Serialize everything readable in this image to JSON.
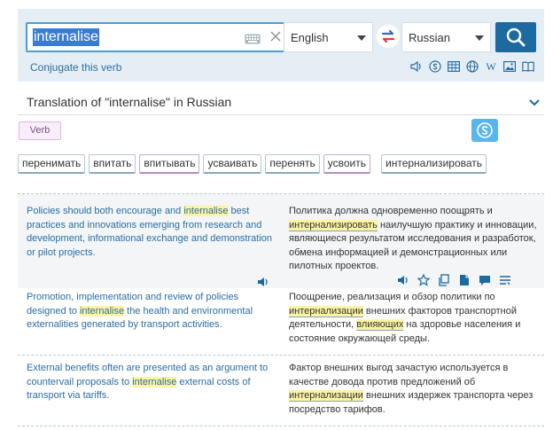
{
  "search": {
    "query": "internalise",
    "source_lang": "English",
    "target_lang": "Russian",
    "conjugate_label": "Conjugate this verb"
  },
  "tools": {
    "icons": [
      "speaker-icon",
      "skype-icon",
      "table-icon",
      "globe-icon",
      "wikipedia-icon",
      "image-icon",
      "book-icon"
    ],
    "wiki_glyph": "W"
  },
  "translation": {
    "title": "Translation of \"internalise\" in Russian",
    "pos": "Verb",
    "words": [
      "перенимать",
      "впитать",
      "впитывать",
      "усваивать",
      "перенять",
      "усвоить",
      "интернализировать"
    ]
  },
  "examples": [
    {
      "src": [
        "Policies should both encourage and ",
        "internalise",
        " best practices and innovations emerging from research and development, informational exchange and demonstration or pilot projects."
      ],
      "tgt_before": "Политика должна одновременно поощрять и ",
      "tgt_hl": "интернализировать",
      "tgt_after": " наилучшую практику и инновации, являющиеся результатом исследования и разработок, обмена информацией и демонстрационных или пилотных проектов."
    },
    {
      "src": [
        "Promotion, implementation and review of policies designed to ",
        "internalise",
        " the health and environmental externalities generated by transport activities."
      ],
      "tgt_before": "Поощрение, реализация и обзор политики по ",
      "tgt_hl": "интернализации",
      "tgt_mid": " внешних факторов транспортной деятельности, ",
      "tgt_ul": "влияющих",
      "tgt_after": " на здоровье населения и состояние окружающей среды."
    },
    {
      "src": [
        "External benefits often are presented as an argument to countervail proposals to ",
        "internalise",
        " external costs of transport via tariffs."
      ],
      "tgt_before": "Фактор внешних выгод зачастую используется в качестве довода против предложений об ",
      "tgt_hl": "интернализации",
      "tgt_after": " внешних издержек транспорта через посредство тарифов."
    }
  ],
  "colors": {
    "accent": "#1c6aa0",
    "link": "#2a6da3",
    "highlight": "#fcf4a3",
    "panel": "#e6eef5"
  }
}
